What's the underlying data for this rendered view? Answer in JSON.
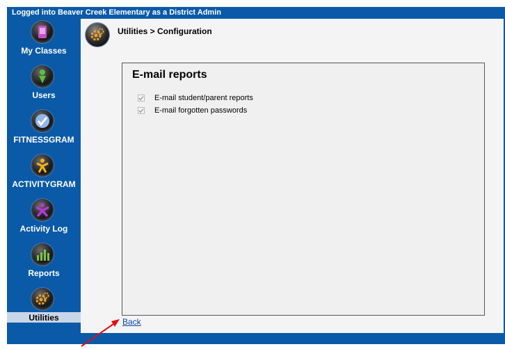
{
  "topbar": {
    "text": "Logged into Beaver Creek Elementary as a District Admin"
  },
  "sidebar": {
    "items": [
      {
        "label": "My Classes",
        "icon": "my-classes-icon"
      },
      {
        "label": "Users",
        "icon": "users-icon"
      },
      {
        "label": "FITNESSGRAM",
        "icon": "fitnessgram-icon"
      },
      {
        "label": "ACTIVITYGRAM",
        "icon": "activitygram-icon"
      },
      {
        "label": "Activity Log",
        "icon": "activity-log-icon"
      },
      {
        "label": "Reports",
        "icon": "reports-icon"
      },
      {
        "label": "Utilities",
        "icon": "utilities-icon",
        "active": true
      }
    ]
  },
  "header": {
    "breadcrumb": "Utilities > Configuration"
  },
  "panel": {
    "title": "E-mail reports",
    "options": [
      {
        "label": "E-mail student/parent reports",
        "checked": true,
        "disabled": true
      },
      {
        "label": "E-mail forgotten passwords",
        "checked": true,
        "disabled": true
      }
    ]
  },
  "footer": {
    "back_label": "Back"
  },
  "colors": {
    "frame": "#0a5aa8",
    "active_bg": "#c9d6ea",
    "link": "#0645ad",
    "arrow": "#e01010"
  }
}
